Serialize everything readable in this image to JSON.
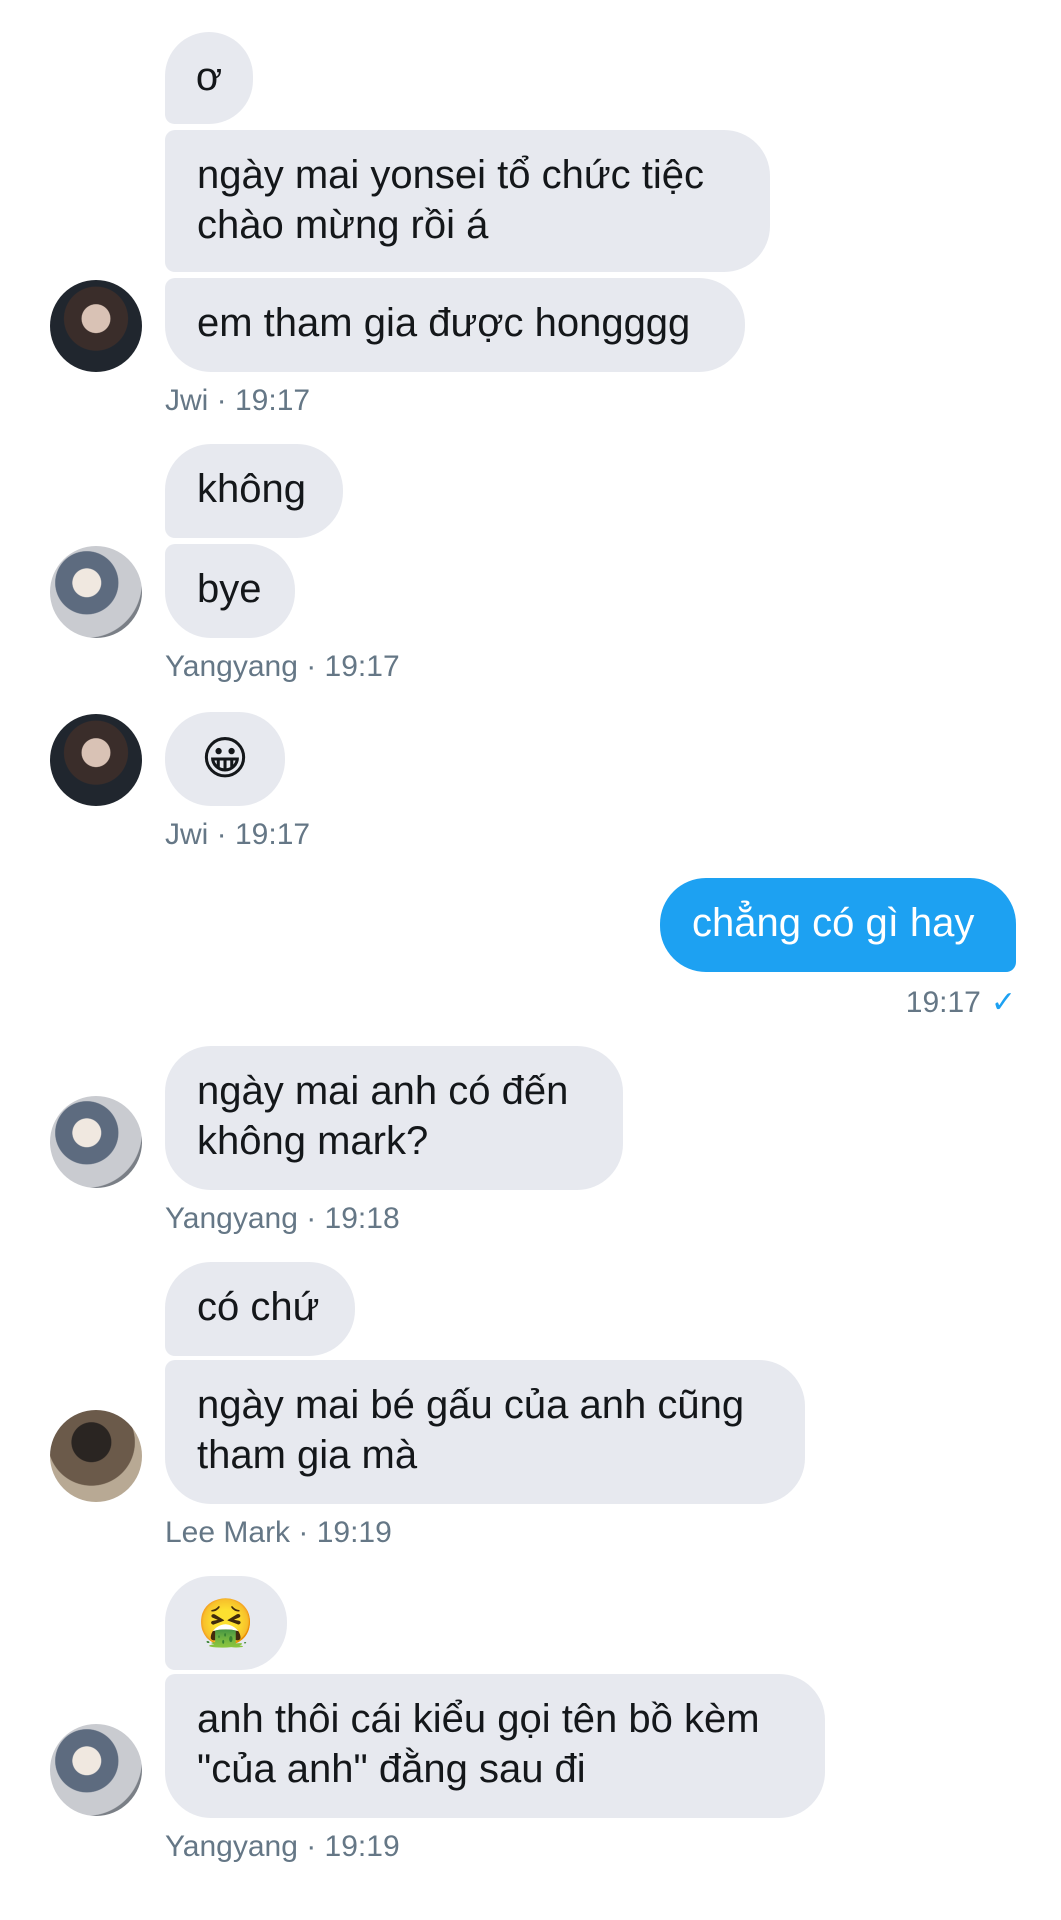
{
  "messages": [
    {
      "text_lines": [
        "ơ"
      ],
      "sender": "Jwi"
    },
    {
      "text_lines": [
        "ngày mai yonsei tổ chức tiệc",
        "chào mừng rồi á"
      ],
      "sender": "Jwi"
    },
    {
      "text_lines": [
        "em tham gia được hongggg"
      ],
      "sender": "Jwi"
    },
    {
      "text_lines": [
        "không"
      ],
      "sender": "Yangyang"
    },
    {
      "text_lines": [
        "bye"
      ],
      "sender": "Yangyang"
    },
    {
      "text_lines": [
        "😀"
      ],
      "sender": "Jwi"
    },
    {
      "text_lines": [
        "chẳng có gì hay"
      ],
      "sender": "me"
    },
    {
      "text_lines": [
        "ngày mai anh có đến",
        "không mark?"
      ],
      "sender": "Yangyang"
    },
    {
      "text_lines": [
        "có chứ"
      ],
      "sender": "Lee Mark"
    },
    {
      "text_lines": [
        "ngày mai bé gấu của anh cũng",
        "tham gia mà"
      ],
      "sender": "Lee Mark"
    },
    {
      "text_lines": [
        "🤮"
      ],
      "sender": "Yangyang"
    },
    {
      "text_lines": [
        "anh thôi cái kiểu gọi tên bồ kèm",
        "\"của anh\" đằng sau đi"
      ],
      "sender": "Yangyang"
    }
  ],
  "meta": [
    {
      "text": "Jwi · 19:17"
    },
    {
      "text": "Yangyang · 19:17"
    },
    {
      "text": "Jwi · 19:17"
    },
    {
      "text": "19:17",
      "read_icon": "checkmark-icon"
    },
    {
      "text": "Yangyang · 19:18"
    },
    {
      "text": "Lee Mark · 19:19"
    },
    {
      "text": "Yangyang · 19:19"
    }
  ],
  "avatars": [
    {
      "name": "Jwi",
      "icon": "avatar-jwi"
    },
    {
      "name": "Yangyang",
      "icon": "avatar-yangyang"
    },
    {
      "name": "Jwi",
      "icon": "avatar-jwi"
    },
    {
      "name": "Yangyang",
      "icon": "avatar-yangyang"
    },
    {
      "name": "Lee Mark",
      "icon": "avatar-lee-mark"
    },
    {
      "name": "Yangyang",
      "icon": "avatar-yangyang"
    }
  ],
  "colors": {
    "incoming_bubble": "#e7e9ef",
    "outgoing_bubble": "#1da1f2",
    "meta_text": "#657786",
    "check": "#1da1f2"
  }
}
